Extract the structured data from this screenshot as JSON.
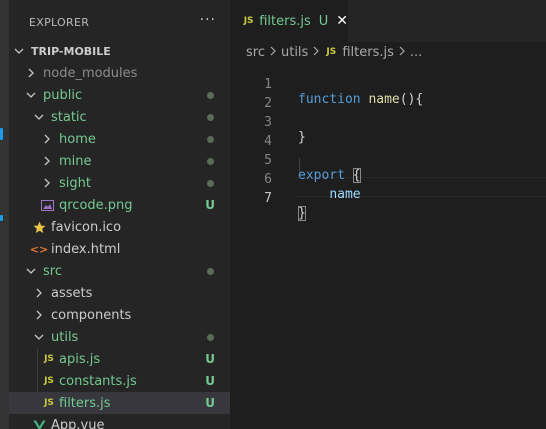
{
  "explorer": {
    "title": "EXPLORER",
    "more": "···",
    "project": "TRIP-MOBILE",
    "items": [
      {
        "label": "node_modules"
      },
      {
        "label": "public"
      },
      {
        "label": "static"
      },
      {
        "label": "home"
      },
      {
        "label": "mine"
      },
      {
        "label": "sight"
      },
      {
        "label": "qrcode.png",
        "status": "U"
      },
      {
        "label": "favicon.ico"
      },
      {
        "label": "index.html"
      },
      {
        "label": "src"
      },
      {
        "label": "assets"
      },
      {
        "label": "components"
      },
      {
        "label": "utils"
      },
      {
        "label": "apis.js",
        "status": "U"
      },
      {
        "label": "constants.js",
        "status": "U"
      },
      {
        "label": "filters.js",
        "status": "U"
      },
      {
        "label": "App.vue"
      }
    ]
  },
  "tab": {
    "icon": "JS",
    "name": "filters.js",
    "status": "U",
    "close": "✕"
  },
  "breadcrumb": {
    "parts": [
      "src",
      "utils",
      "filters.js",
      "..."
    ],
    "icon": "JS"
  },
  "code": {
    "line_numbers": [
      "1",
      "2",
      "3",
      "4",
      "5",
      "6",
      "7"
    ],
    "line1_kw": "function",
    "line1_fn": "name",
    "line1_rest": "(){",
    "line3": "}",
    "line5_kw": "export",
    "line5_brace": "{",
    "line6_prop": "name",
    "line7": "}"
  },
  "colors": {
    "git_untracked": "#73c991",
    "js_icon": "#cbcb41",
    "keyword": "#569cd6",
    "function": "#dcdcaa"
  }
}
